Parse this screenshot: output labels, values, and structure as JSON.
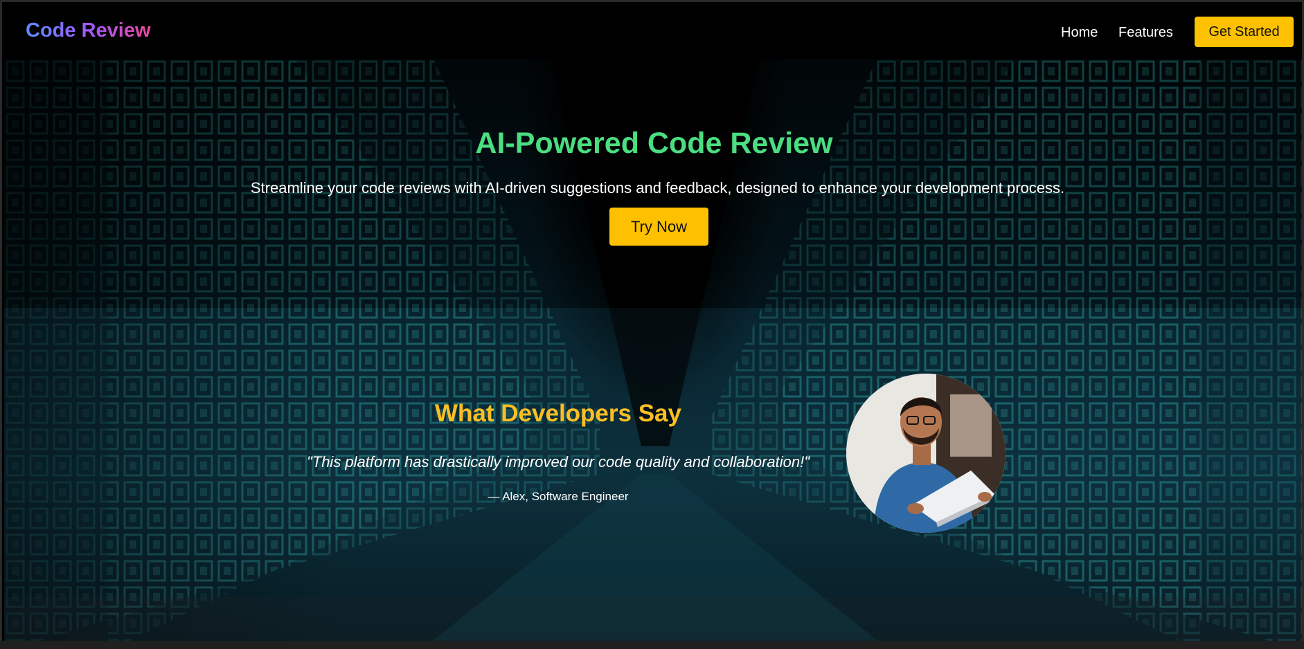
{
  "header": {
    "logo": "Code Review",
    "nav": [
      {
        "label": "Home"
      },
      {
        "label": "Features"
      }
    ],
    "cta_label": "Get Started"
  },
  "hero": {
    "title": "AI-Powered Code Review",
    "subtitle": "Streamline your code reviews with AI-driven suggestions and feedback, designed to enhance your development process.",
    "button_label": "Try Now"
  },
  "testimonial": {
    "title": "What Developers Say",
    "quote": "\"This platform has drastically improved our code quality and collaboration!\"",
    "author": "— Alex, Software Engineer"
  },
  "colors": {
    "accent": "#fdc100",
    "hero_title": "#4ade80",
    "testimonial_title": "#fbbf24",
    "background": "#000000"
  }
}
